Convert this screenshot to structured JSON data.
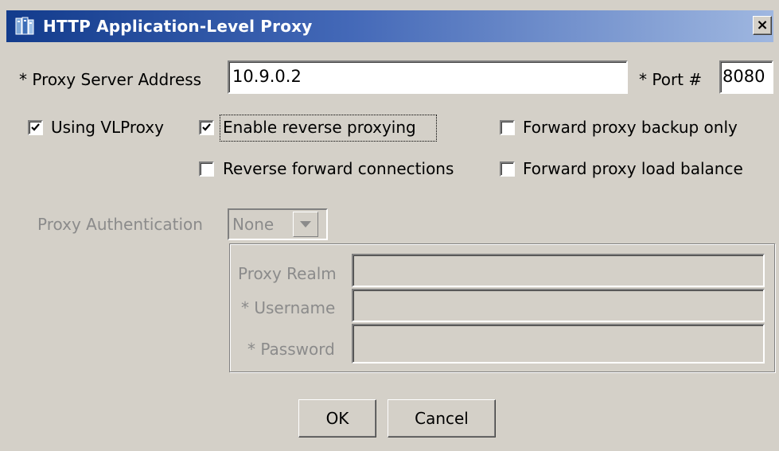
{
  "window": {
    "title": "HTTP Application-Level Proxy",
    "close_glyph": "×"
  },
  "proxy": {
    "address_label": "* Proxy Server Address",
    "address_value": "10.9.0.2",
    "port_label": "* Port #",
    "port_value": "8080"
  },
  "options": {
    "using_vlproxy": {
      "label": "Using VLProxy",
      "checked": true
    },
    "enable_reverse": {
      "label": "Enable reverse proxying",
      "checked": true
    },
    "forward_backup": {
      "label": "Forward proxy backup only",
      "checked": false
    },
    "reverse_forward": {
      "label": "Reverse forward connections",
      "checked": false
    },
    "forward_balance": {
      "label": "Forward proxy load balance",
      "checked": false
    }
  },
  "auth": {
    "label": "Proxy Authentication",
    "selected": "None",
    "realm_label": "Proxy Realm",
    "username_label": "* Username",
    "password_label": "* Password",
    "realm_value": "",
    "username_value": "",
    "password_value": ""
  },
  "buttons": {
    "ok": "OK",
    "cancel": "Cancel"
  },
  "icons": {
    "title": "proxy-app-icon",
    "check": "check-mark-icon",
    "dropdown": "triangle-down-icon"
  },
  "colors": {
    "title_start": "#123b8c",
    "title_end": "#9fb7e0",
    "face": "#d4d0c8",
    "disabled_text": "#8b8b8b"
  }
}
